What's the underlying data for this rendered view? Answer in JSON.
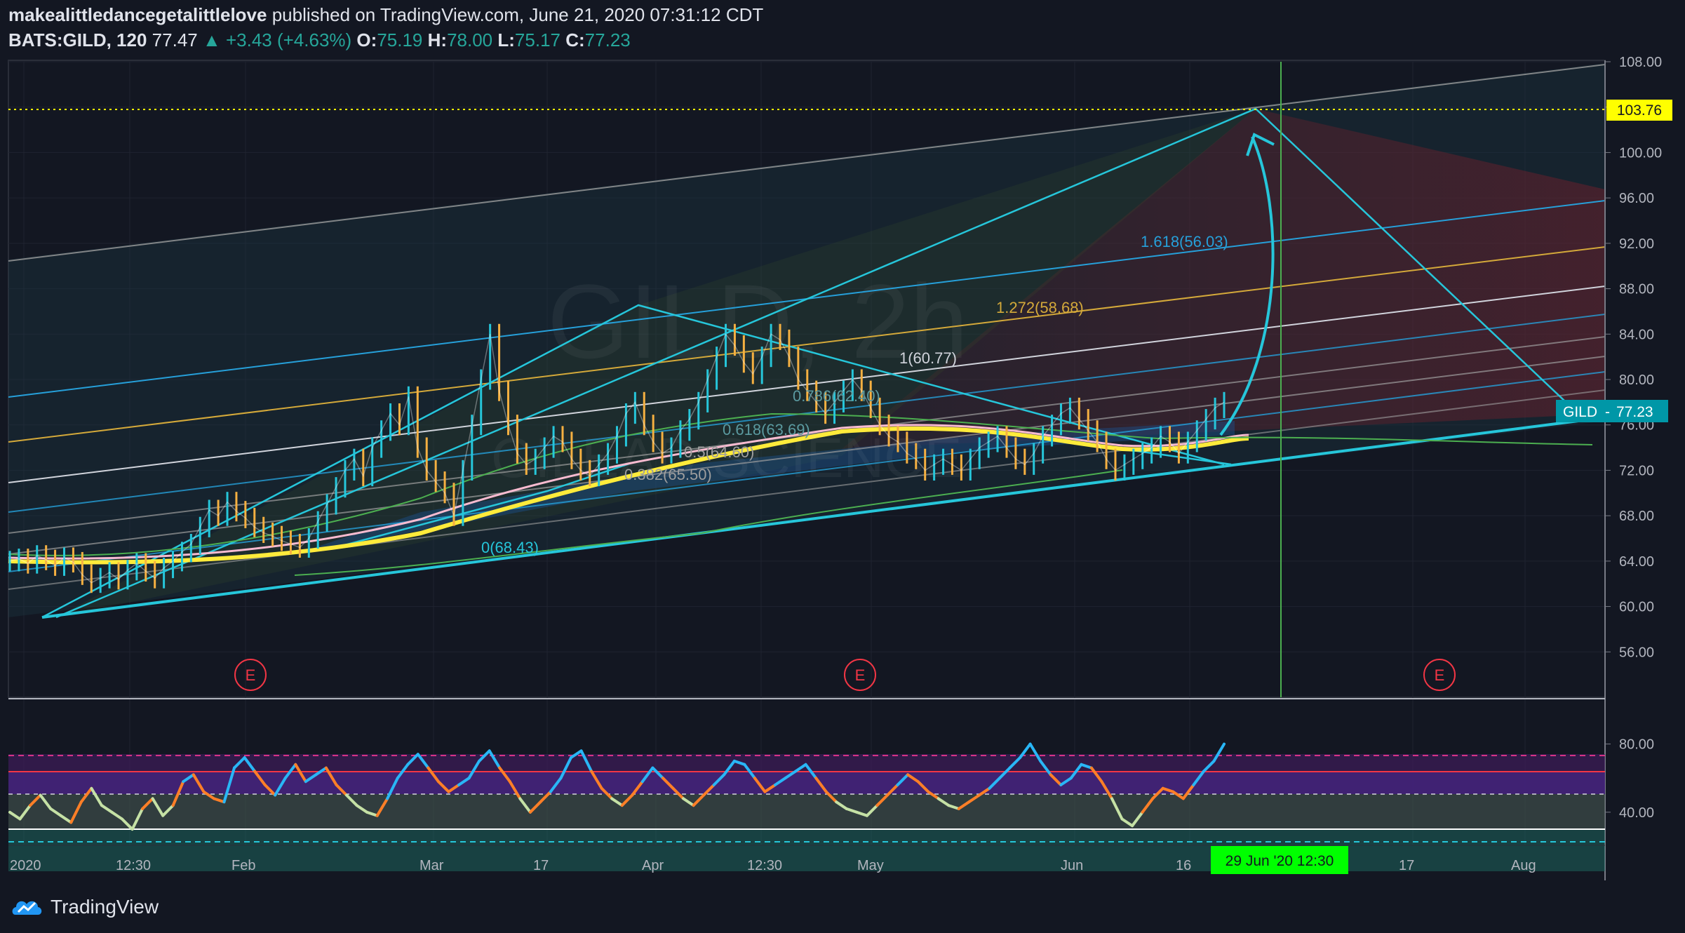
{
  "header": {
    "author": "makealittledancegetalittlelove",
    "published_text": "published on TradingView.com, June 21, 2020 07:31:12 CDT",
    "symbol": "BATS:GILD, 120",
    "last": "77.47",
    "arrow": "▲",
    "change": "+3.43 (+4.63%)",
    "o_label": "O:",
    "o_value": "75.19",
    "h_label": "H:",
    "h_value": "78.00",
    "l_label": "L:",
    "l_value": "75.17",
    "c_label": "C:",
    "c_value": "77.23"
  },
  "watermark": {
    "line1": "GILD, 2h",
    "line2": "GILEAD SCIENCE"
  },
  "footer": {
    "brand": "TradingView"
  },
  "colors": {
    "background": "#131722",
    "cyan": "#26c6da",
    "yellow": "#ffeb3b",
    "hline": "#ffff00",
    "vline": "#4caf50",
    "label_bg_green": "#00ff00",
    "price_tag": "#0097a7"
  },
  "chart_data": [
    {
      "type": "line",
      "title": "",
      "y_axis_ticks": [
        "108.00",
        "104.00",
        "100.00",
        "96.00",
        "92.00",
        "88.00",
        "84.00",
        "80.00",
        "76.00",
        "72.00",
        "68.00",
        "64.00",
        "60.00",
        "56.00"
      ],
      "ylim": [
        52,
        108
      ],
      "x_axis_ticks": [
        "2020",
        "12:30",
        "Feb",
        "Mar",
        "17",
        "Apr",
        "12:30",
        "May",
        "Jun",
        "16",
        "17",
        "Aug"
      ],
      "current_price_label": {
        "symbol": "GILD",
        "value": "77.23"
      },
      "horizontal_level": "103.76",
      "vertical_marker_label": "29 Jun '20   12:30",
      "fib_labels": [
        {
          "text": "1.618(56.03)",
          "color": "#26a0da"
        },
        {
          "text": "1.272(58.68)",
          "color": "#d4a93a"
        },
        {
          "text": "1(60.77)",
          "color": "#d1d4dc"
        },
        {
          "text": "0.786(62.40)",
          "color": "#5b9aa0"
        },
        {
          "text": "0.618(63.69)",
          "color": "#5b9aa0"
        },
        {
          "text": "0.5(64.60)",
          "color": "#9e9e9e"
        },
        {
          "text": "0.382(65.50)",
          "color": "#9e9e9e"
        },
        {
          "text": "0(68.43)",
          "color": "#26c6da"
        }
      ],
      "earnings_marker": "E",
      "price_series": {
        "name": "",
        "values": [
          64.0,
          64.2,
          63.8,
          64.5,
          64.1,
          63.6,
          64.3,
          63.9,
          62.8,
          62.1,
          62.5,
          63.0,
          62.4,
          63.2,
          63.8,
          63.1,
          62.5,
          63.4,
          64.0,
          64.8,
          65.5,
          67.0,
          68.5,
          68.0,
          69.2,
          68.4,
          67.8,
          67.0,
          66.5,
          66.2,
          65.8,
          65.5,
          65.2,
          66.0,
          67.5,
          69.0,
          70.5,
          72.0,
          73.0,
          71.5,
          74.0,
          75.5,
          77.0,
          76.0,
          78.5,
          74.0,
          72.0,
          71.0,
          70.0,
          68.0,
          72.0,
          76.0,
          80.0,
          84.0,
          79.0,
          76.0,
          73.5,
          72.5,
          73.0,
          74.0,
          75.0,
          74.5,
          73.0,
          72.0,
          71.5,
          72.5,
          73.5,
          75.0,
          77.0,
          78.0,
          76.0,
          74.5,
          73.5,
          74.0,
          75.5,
          76.5,
          78.0,
          80.0,
          82.0,
          84.0,
          83.0,
          81.5,
          80.5,
          82.0,
          84.0,
          83.5,
          82.0,
          80.0,
          79.0,
          78.0,
          77.0,
          78.0,
          79.0,
          80.0,
          79.0,
          77.5,
          76.0,
          75.0,
          74.5,
          73.5,
          73.0,
          72.0,
          72.5,
          73.0,
          72.5,
          72.0,
          73.0,
          74.0,
          74.5,
          75.0,
          74.0,
          73.0,
          72.5,
          73.5,
          75.0,
          76.0,
          77.0,
          77.5,
          76.5,
          75.5,
          74.5,
          73.0,
          72.0,
          72.5,
          73.0,
          73.5,
          74.0,
          75.0,
          74.5,
          73.5,
          74.5,
          75.5,
          76.5,
          77.5,
          78.0
        ]
      }
    },
    {
      "type": "line",
      "title": "",
      "y_axis_ticks": [
        "80.00",
        "40.00"
      ],
      "ylim": [
        0,
        100
      ],
      "rsi_series": {
        "name": "",
        "values": [
          40,
          36,
          44,
          50,
          42,
          38,
          34,
          46,
          54,
          44,
          40,
          36,
          30,
          42,
          48,
          38,
          44,
          58,
          62,
          52,
          48,
          46,
          66,
          72,
          64,
          56,
          50,
          60,
          68,
          58,
          62,
          66,
          56,
          50,
          44,
          40,
          38,
          48,
          60,
          68,
          74,
          66,
          58,
          52,
          56,
          60,
          70,
          76,
          66,
          58,
          48,
          40,
          46,
          52,
          60,
          72,
          76,
          64,
          54,
          48,
          44,
          50,
          58,
          66,
          60,
          54,
          48,
          44,
          50,
          56,
          62,
          70,
          68,
          60,
          52,
          56,
          60,
          64,
          68,
          60,
          52,
          46,
          42,
          40,
          38,
          44,
          50,
          56,
          62,
          58,
          52,
          48,
          44,
          42,
          46,
          50,
          54,
          60,
          66,
          72,
          80,
          70,
          62,
          56,
          60,
          68,
          66,
          58,
          48,
          36,
          32,
          40,
          48,
          54,
          52,
          48,
          56,
          64,
          70,
          80
        ]
      }
    }
  ]
}
